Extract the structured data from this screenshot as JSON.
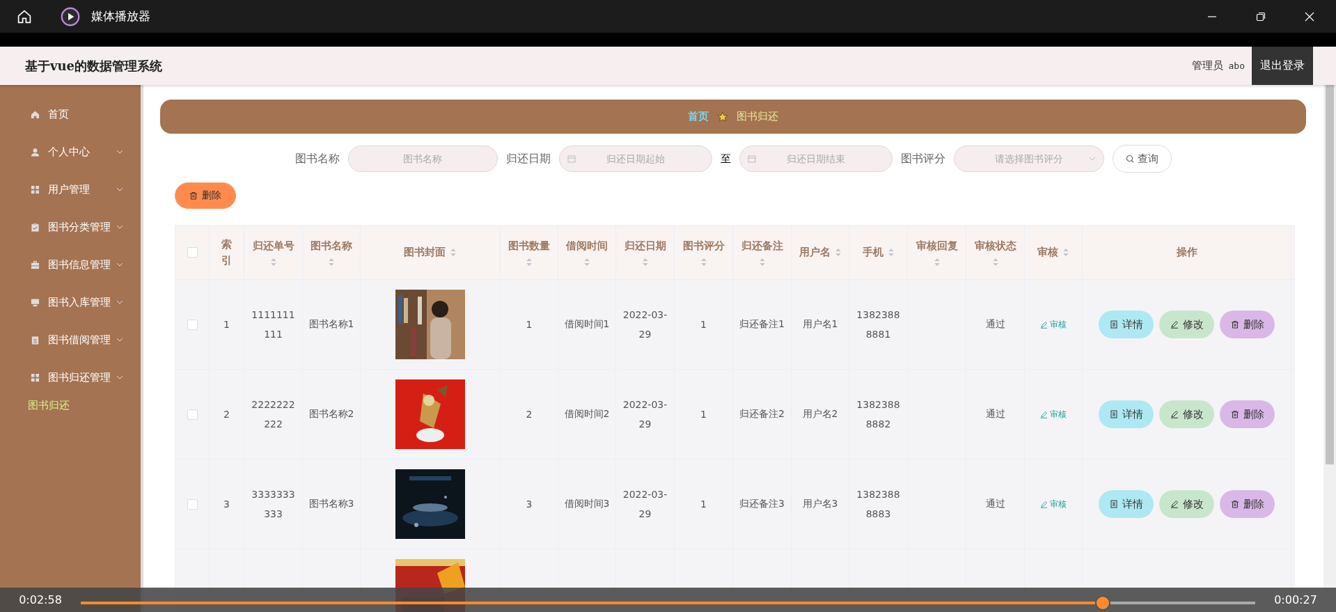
{
  "player": {
    "title": "媒体播放器",
    "elapsed": "0:02:58",
    "remaining": "0:00:27",
    "level": 0.87
  },
  "header": {
    "title": "基于vue的数据管理系统",
    "role": "管理员",
    "user": "abo",
    "logout": "退出登录"
  },
  "sidebar": {
    "items": [
      {
        "label": "首页",
        "expandable": false
      },
      {
        "label": "个人中心",
        "expandable": true
      },
      {
        "label": "用户管理",
        "expandable": true
      },
      {
        "label": "图书分类管理",
        "expandable": true
      },
      {
        "label": "图书信息管理",
        "expandable": true
      },
      {
        "label": "图书入库管理",
        "expandable": true
      },
      {
        "label": "图书借阅管理",
        "expandable": true
      },
      {
        "label": "图书归还管理",
        "expandable": true,
        "children": [
          {
            "label": "图书归还",
            "selected": true
          }
        ]
      }
    ]
  },
  "breadcrumb": [
    "首页",
    "图书归还"
  ],
  "filters": [
    {
      "kind": "text",
      "label": "图书名称",
      "placeholder": "图书名称"
    },
    {
      "kind": "daterange",
      "label": "归还日期",
      "placeholder": "归还日期起始",
      "separator": "至",
      "end_placeholder": "归还日期结束"
    },
    {
      "kind": "select",
      "label": "图书评分",
      "placeholder": "请选择图书评分"
    }
  ],
  "search_button": "查询",
  "delete_button": "删除",
  "table": {
    "header_checked": false,
    "columns": [
      {
        "label": "索引",
        "sortable": false
      },
      {
        "label": "归还单号",
        "sortable": true
      },
      {
        "label": "图书名称",
        "sortable": true
      },
      {
        "label": "图书封面",
        "sortable": true
      },
      {
        "label": "图书数量",
        "sortable": true
      },
      {
        "label": "借阅时间",
        "sortable": true
      },
      {
        "label": "归还日期",
        "sortable": true
      },
      {
        "label": "图书评分",
        "sortable": true
      },
      {
        "label": "归还备注",
        "sortable": true
      },
      {
        "label": "用户名",
        "sortable": true
      },
      {
        "label": "手机",
        "sortable": true
      },
      {
        "label": "审核回复",
        "sortable": true
      },
      {
        "label": "审核状态",
        "sortable": true
      },
      {
        "label": "审核",
        "sortable": true
      },
      {
        "label": "操作",
        "sortable": false
      }
    ],
    "rows": [
      {
        "checked": false,
        "index": "1",
        "order_no": "1111111111",
        "name": "图书名称1",
        "cover": {
          "kind": "picture"
        },
        "quantity": "1",
        "borrow_time": "借阅时间1",
        "return_date": "2022-03-29",
        "rating": "1",
        "note": "归还备注1",
        "username": "用户名1",
        "phone": "13823888881",
        "status": "通过",
        "audit": "审核",
        "actions": [
          "详情",
          "修改",
          "删除"
        ]
      },
      {
        "checked": false,
        "index": "2",
        "order_no": "2222222222",
        "name": "图书名称2",
        "cover": {
          "kind": "picture"
        },
        "quantity": "2",
        "borrow_time": "借阅时间2",
        "return_date": "2022-03-29",
        "rating": "1",
        "note": "归还备注2",
        "username": "用户名2",
        "phone": "13823888882",
        "status": "通过",
        "audit": "审核",
        "actions": [
          "详情",
          "修改",
          "删除"
        ]
      },
      {
        "checked": false,
        "index": "3",
        "order_no": "3333333333",
        "name": "图书名称3",
        "cover": {
          "kind": "picture"
        },
        "quantity": "3",
        "borrow_time": "借阅时间3",
        "return_date": "2022-03-29",
        "rating": "1",
        "note": "归还备注3",
        "username": "用户名3",
        "phone": "13823888883",
        "status": "通过",
        "audit": "审核",
        "actions": [
          "详情",
          "修改",
          "删除"
        ]
      },
      {
        "cover": {
          "kind": "picture"
        }
      }
    ]
  }
}
